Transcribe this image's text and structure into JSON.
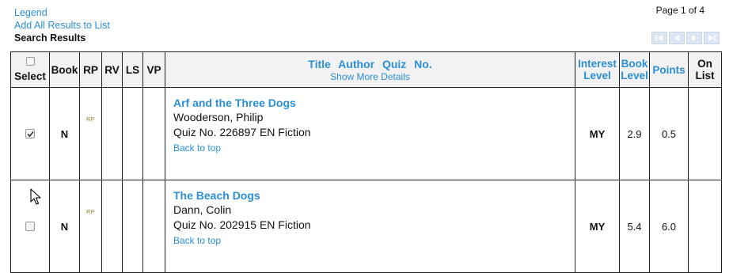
{
  "links": {
    "legend": "Legend",
    "add_all": "Add All Results to List"
  },
  "section_title": "Search Results",
  "pagination": {
    "label": "Page 1 of 4",
    "icons": [
      "first-page-icon",
      "previous-page-icon",
      "next-page-icon",
      "last-page-icon"
    ]
  },
  "table": {
    "headers": {
      "select": "Select",
      "book": "Book",
      "rp": "RP",
      "rv": "RV",
      "ls": "LS",
      "vp": "VP",
      "title_author_quiz": "Title  Author  Quiz No.",
      "show_more": "Show More Details",
      "interest_level": "Interest Level",
      "book_level": "Book Level",
      "points": "Points",
      "on_list": "On List"
    },
    "rows": [
      {
        "checked": true,
        "book": "N",
        "rp": "RP",
        "title": "Arf and the Three Dogs",
        "author": "Wooderson, Philip",
        "quiz": "Quiz No. 226897 EN Fiction",
        "back": "Back to top",
        "interest": "MY",
        "book_level": "2.9",
        "points": "0.5",
        "on_list": ""
      },
      {
        "checked": false,
        "book": "N",
        "rp": "RP",
        "title": "The Beach Dogs",
        "author": "Dann, Colin",
        "quiz": "Quiz No. 202915 EN Fiction",
        "back": "Back to top",
        "interest": "MY",
        "book_level": "5.4",
        "points": "6.0",
        "on_list": ""
      }
    ]
  },
  "colors": {
    "link": "#2b8fd6",
    "header_bg": "#f2f2f2",
    "border": "#222222",
    "pager_bg": "#dbe7f2"
  }
}
